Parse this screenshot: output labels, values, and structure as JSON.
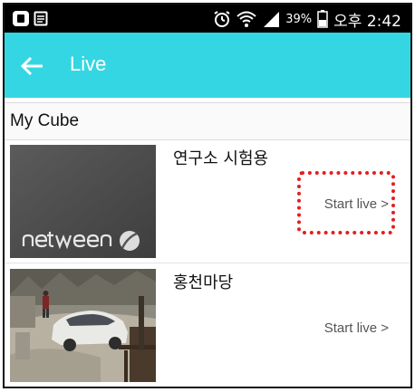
{
  "status_bar": {
    "battery_percent": "39%",
    "time": "오후 2:42",
    "icons": [
      "app-icon",
      "message-icon",
      "alarm-icon",
      "wifi-icon",
      "signal-icon",
      "battery-icon"
    ]
  },
  "app_bar": {
    "back_icon": "arrow-left-icon",
    "title": "Live",
    "background": "#35d6e3"
  },
  "section": {
    "title": "My Cube"
  },
  "cameras": [
    {
      "name": "연구소 시험용",
      "action_label": "Start live >",
      "thumbnail": "netween-logo-placeholder"
    },
    {
      "name": "홍천마당",
      "action_label": "Start live >",
      "thumbnail": "yard-camera-snapshot"
    }
  ],
  "highlight_color": "#e31e1e"
}
